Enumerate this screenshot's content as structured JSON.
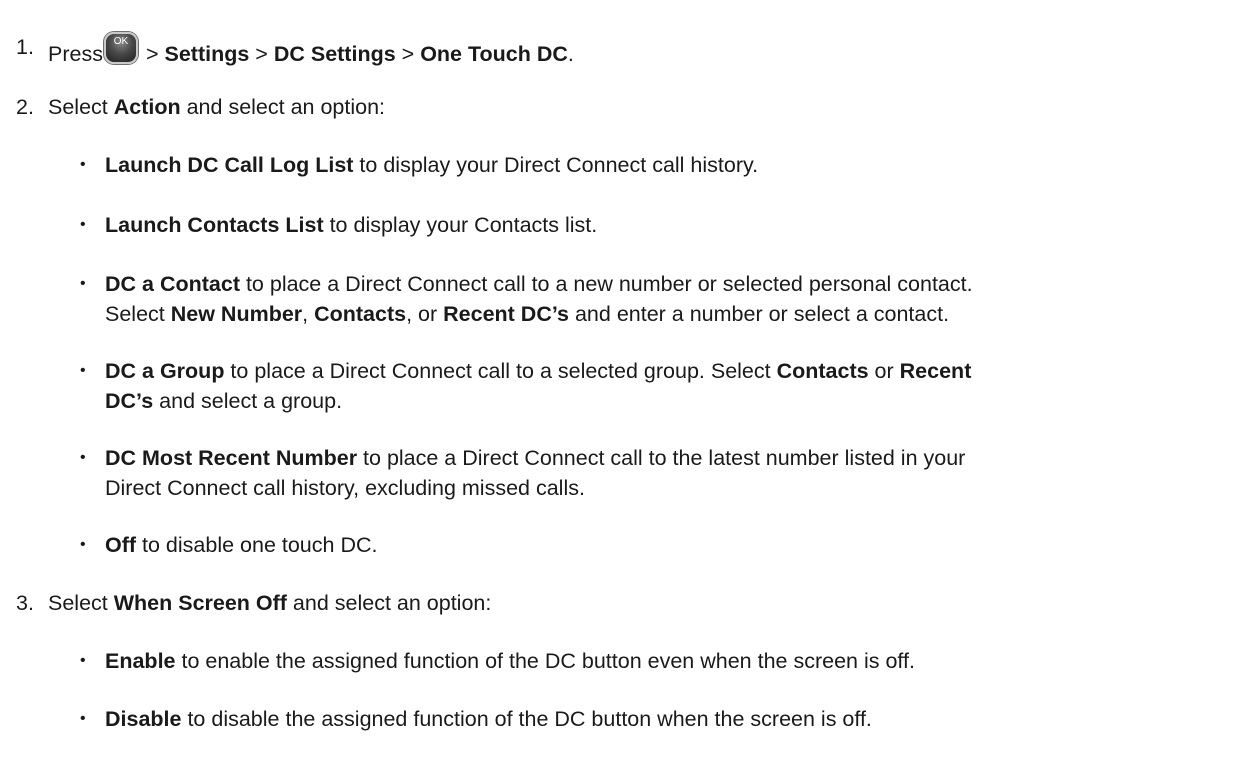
{
  "steps": [
    {
      "number": "1.",
      "press": "Press",
      "ok_key_label": "OK",
      "sep1": " > ",
      "menu1": "Settings",
      "sep2": " > ",
      "menu2": "DC Settings",
      "sep3": " > ",
      "menu3": "One Touch DC",
      "end": "."
    },
    {
      "number": "2.",
      "pre": "Select ",
      "bold": "Action",
      "post": " and select an option:",
      "bullets": [
        {
          "lines": [
            {
              "bold": "Launch DC Call Log List",
              "text": " to display your Direct Connect call history."
            }
          ]
        },
        {
          "lines": [
            {
              "bold": "Launch Contacts List",
              "text": " to display your Contacts list."
            }
          ]
        },
        {
          "lines": [
            {
              "bold": "DC a Contact",
              "text": " to place a Direct Connect call to a new number or selected personal contact."
            },
            {
              "t1": "Select ",
              "b1": "New Number",
              "t2": ", ",
              "b2": "Contacts",
              "t3": ", or ",
              "b3": "Recent DC’s",
              "t4": " and enter a number or select a contact."
            }
          ]
        },
        {
          "lines": [
            {
              "bold": "DC a Group",
              "text": " to place a Direct Connect call to a selected group. Select ",
              "b2": "Contacts",
              "t3": " or ",
              "b3": "Recent"
            },
            {
              "bold": "DC’s",
              "text": " and select a group."
            }
          ]
        },
        {
          "lines": [
            {
              "bold": "DC Most Recent Number",
              "text": " to place a Direct Connect call to the latest number listed in your"
            },
            {
              "text": "Direct Connect call history, excluding missed calls."
            }
          ]
        },
        {
          "lines": [
            {
              "bold": "Off",
              "text": " to disable one touch DC."
            }
          ]
        }
      ]
    },
    {
      "number": "3.",
      "pre": "Select ",
      "bold": "When Screen Off",
      "post": " and select an option:",
      "bullets": [
        {
          "lines": [
            {
              "bold": "Enable",
              "text": " to enable the assigned function of the DC button even when the screen is off."
            }
          ]
        },
        {
          "lines": [
            {
              "bold": "Disable",
              "text": " to disable the assigned function of the DC button when the screen is off."
            }
          ]
        }
      ]
    }
  ],
  "bullet_glyph": "•"
}
